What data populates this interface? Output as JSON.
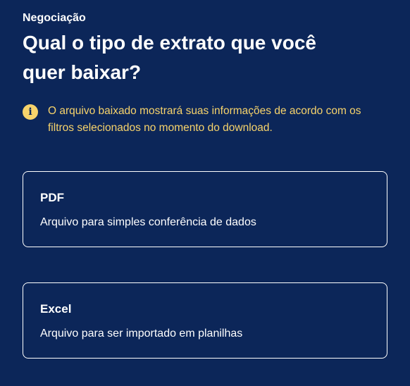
{
  "header": {
    "eyebrow": "Negociação",
    "title": "Qual o tipo de extrato que você quer baixar?"
  },
  "notice": {
    "icon": "info-icon",
    "text": "O arquivo baixado mostrará suas informações de acordo com os filtros selecionados no momento do download."
  },
  "options": [
    {
      "title": "PDF",
      "description": "Arquivo para simples conferência de dados"
    },
    {
      "title": "Excel",
      "description": "Arquivo para ser importado em planilhas"
    }
  ],
  "colors": {
    "background": "#0c2659",
    "accent": "#f7d36b",
    "text": "#ffffff"
  }
}
